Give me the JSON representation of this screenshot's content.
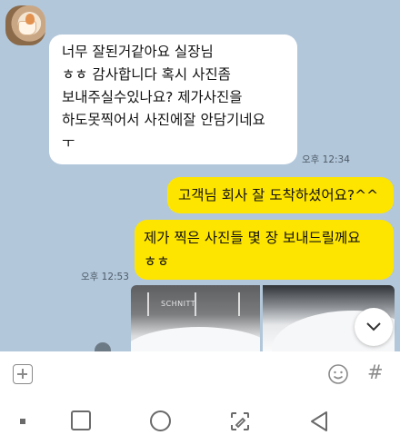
{
  "chat": {
    "incoming": {
      "lines": [
        "너무 잘된거같아요 실장님",
        "ㅎㅎ 감사합니다   혹시 사진좀",
        "보내주실수있나요? 제가사진을",
        "하도못찍어서 사진에잘 안담기네요",
        "ㅜ"
      ],
      "time": "오후 12:34"
    },
    "outgoing": [
      {
        "text": "고객님 회사 잘 도착하셨어요?^^"
      },
      {
        "lines": [
          "제가 찍은 사진들 몇 장 보내드릴께요",
          "ㅎㅎ"
        ]
      }
    ],
    "outgoing_time": "오후 12:53",
    "photo_logo_text": "SCHNITT"
  },
  "input_bar": {
    "plus_icon": "plus-icon",
    "emoji_icon": "emoji-icon",
    "hash_label": "#"
  },
  "nav": [
    "recent-apps-dot",
    "home-square",
    "home-circle",
    "screen-capture-icon",
    "back-icon"
  ],
  "colors": {
    "chat_bg": "#b2c7da",
    "outgoing_bubble": "#fee500",
    "incoming_bubble": "#ffffff"
  }
}
